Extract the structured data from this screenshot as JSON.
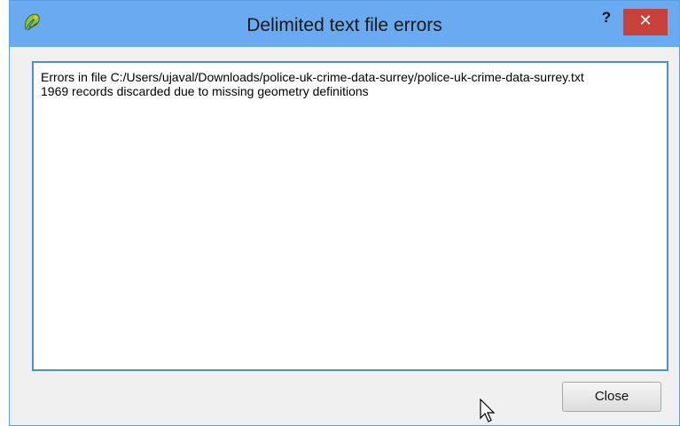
{
  "dialog": {
    "title": "Delimited text file errors",
    "help_label": "?",
    "close_icon_label": "✕",
    "close_button_label": "Close"
  },
  "messages": {
    "line1": "Errors in file C:/Users/ujaval/Downloads/police-uk-crime-data-surrey/police-uk-crime-data-surrey.txt",
    "line2": "1969 records discarded due to missing geometry definitions"
  },
  "icons": {
    "app": "qgis-icon",
    "cursor": "mouse-pointer-icon"
  },
  "colors": {
    "titlebar": "#6aaaf0",
    "close_x_bg": "#c8413b",
    "text_border": "#4a90d9"
  }
}
